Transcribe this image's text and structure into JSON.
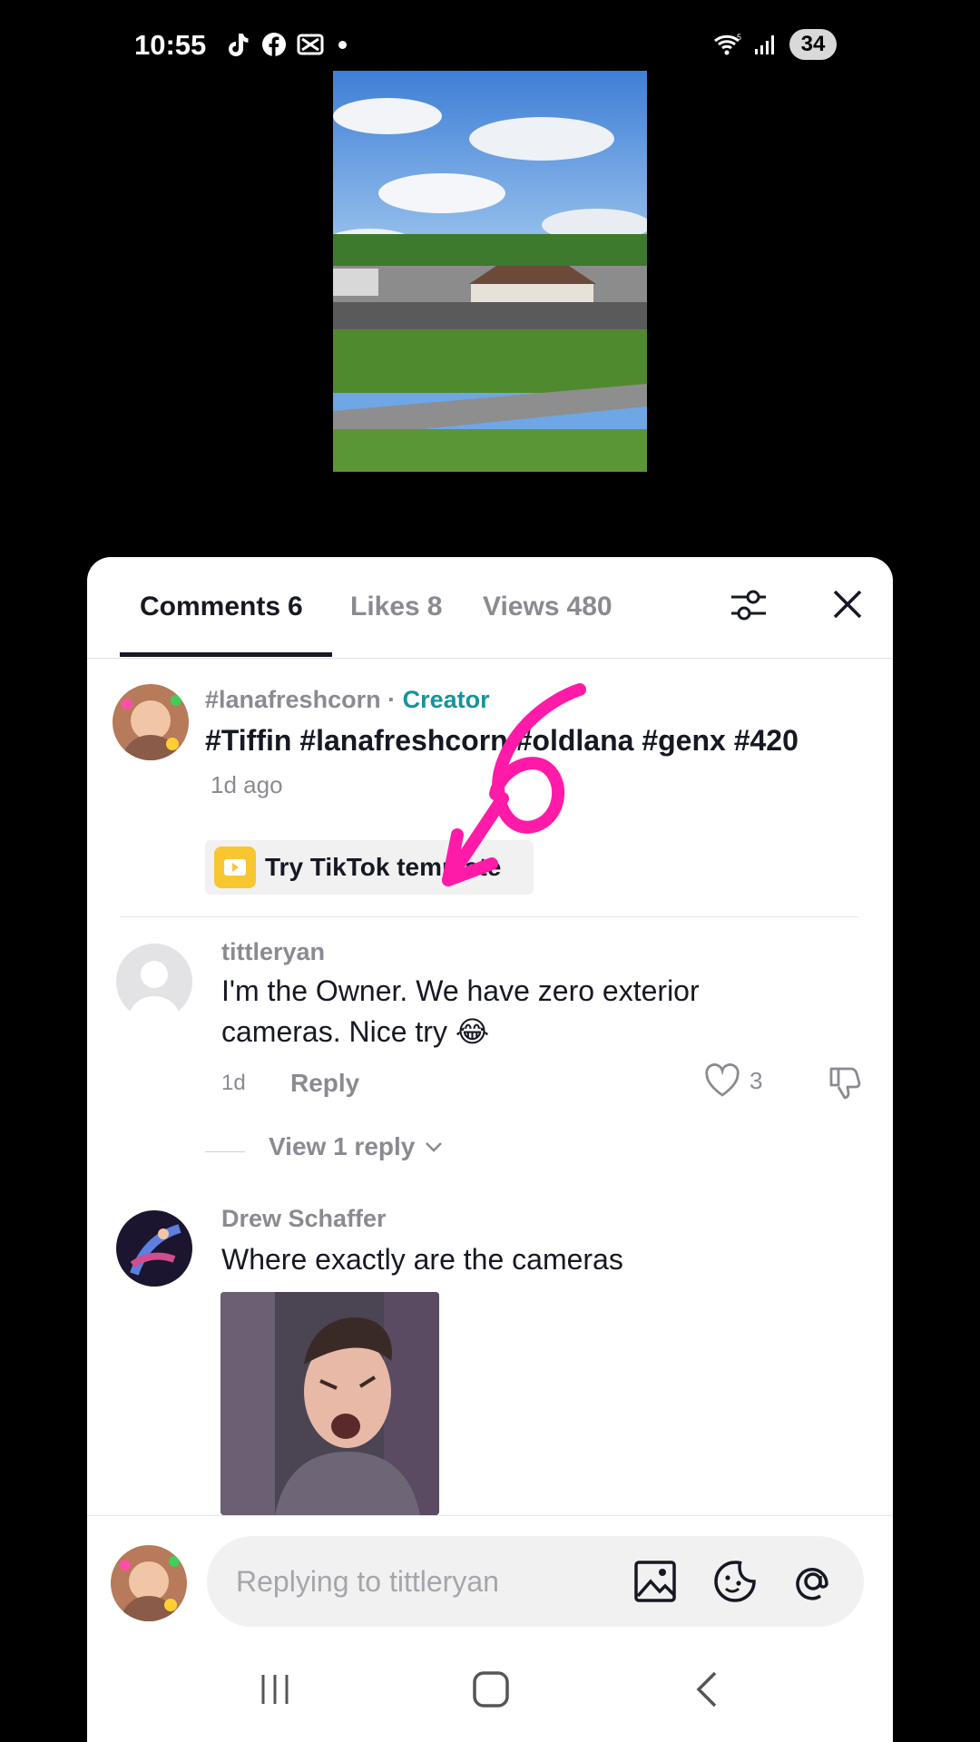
{
  "status_bar": {
    "time": "10:55",
    "app_icons": [
      "tiktok-icon",
      "facebook-icon",
      "capcut-icon"
    ],
    "battery": "34",
    "network": "5"
  },
  "tabs": {
    "comments_label": "Comments",
    "comments_count": "6",
    "likes_label": "Likes",
    "likes_count": "8",
    "views_label": "Views",
    "views_count": "480"
  },
  "creator_post": {
    "username": "#lanafreshcorn",
    "separator": "·",
    "badge": "Creator",
    "caption": "#Tiffin #lanafreshcorn #oldlana #genx #420",
    "time": "1d ago",
    "template_button": "Try TikTok template"
  },
  "comments": [
    {
      "username": "tittleryan",
      "text_line1": "I'm the Owner. We have zero exterior",
      "text_line2": "cameras. Nice try 😂",
      "time": "1d",
      "reply_label": "Reply",
      "likes": "3",
      "view_replies": "View 1 reply"
    },
    {
      "username": "Drew Schaffer",
      "text": "Where exactly are the cameras"
    }
  ],
  "input": {
    "placeholder": "Replying to tittleryan"
  },
  "annotation": {
    "text": "6",
    "color": "#ff1aa8"
  },
  "colors": {
    "creator_badge": "#17939c",
    "annotation": "#ff1aa8",
    "template_icon": "#f7c631"
  }
}
